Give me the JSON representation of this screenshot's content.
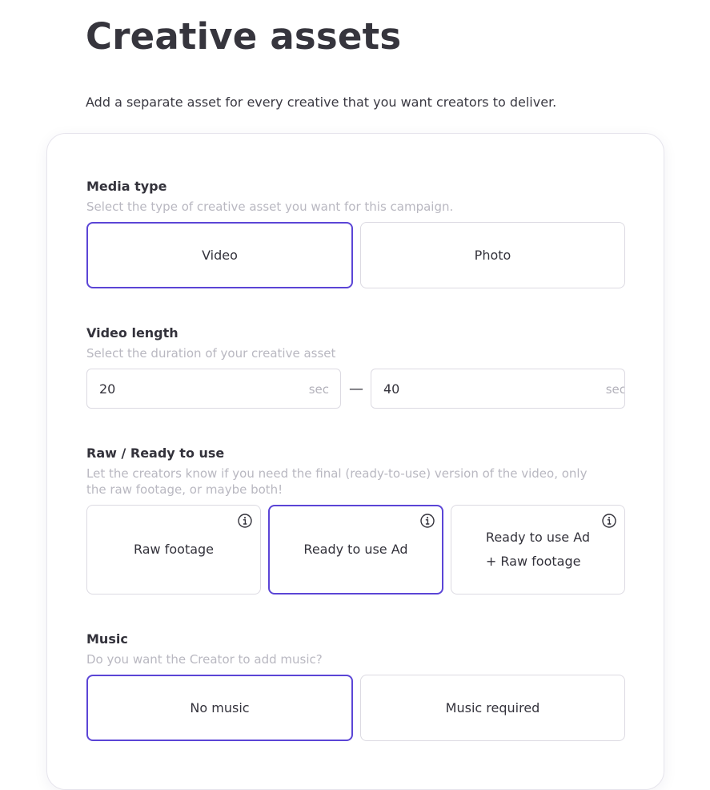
{
  "page": {
    "title": "Creative assets",
    "subtitle": "Add a separate asset for every creative that you want creators to deliver."
  },
  "media_type": {
    "title": "Media type",
    "description": "Select the type of creative asset you want for this campaign.",
    "options": [
      {
        "label": "Video",
        "selected": true
      },
      {
        "label": "Photo",
        "selected": false
      }
    ]
  },
  "video_length": {
    "title": "Video length",
    "description": "Select the duration of your creative asset",
    "min_value": "20",
    "max_value": "40",
    "min_unit": "sec",
    "max_unit": "sec",
    "separator": "—"
  },
  "raw_ready": {
    "title": "Raw / Ready to use",
    "description_line1": "Let the creators know if you need the final (ready-to-use) version of the video, only",
    "description_line2": "the raw footage, or maybe both!",
    "options": [
      {
        "label": "Raw footage",
        "selected": false,
        "icon": "info-icon"
      },
      {
        "label": "Ready to use Ad",
        "selected": true,
        "icon": "info-icon"
      },
      {
        "label_line1": "Ready to use Ad",
        "label_line2": "+ Raw footage",
        "selected": false,
        "icon": "info-icon"
      }
    ]
  },
  "music": {
    "title": "Music",
    "description": "Do you want the Creator to add music?",
    "options": [
      {
        "label": "No music",
        "selected": true
      },
      {
        "label": "Music required",
        "selected": false
      }
    ]
  },
  "colors": {
    "accent": "#5b45d6",
    "border": "#dcdae2",
    "muted_text": "#b9b8c1",
    "text": "#33323b"
  }
}
